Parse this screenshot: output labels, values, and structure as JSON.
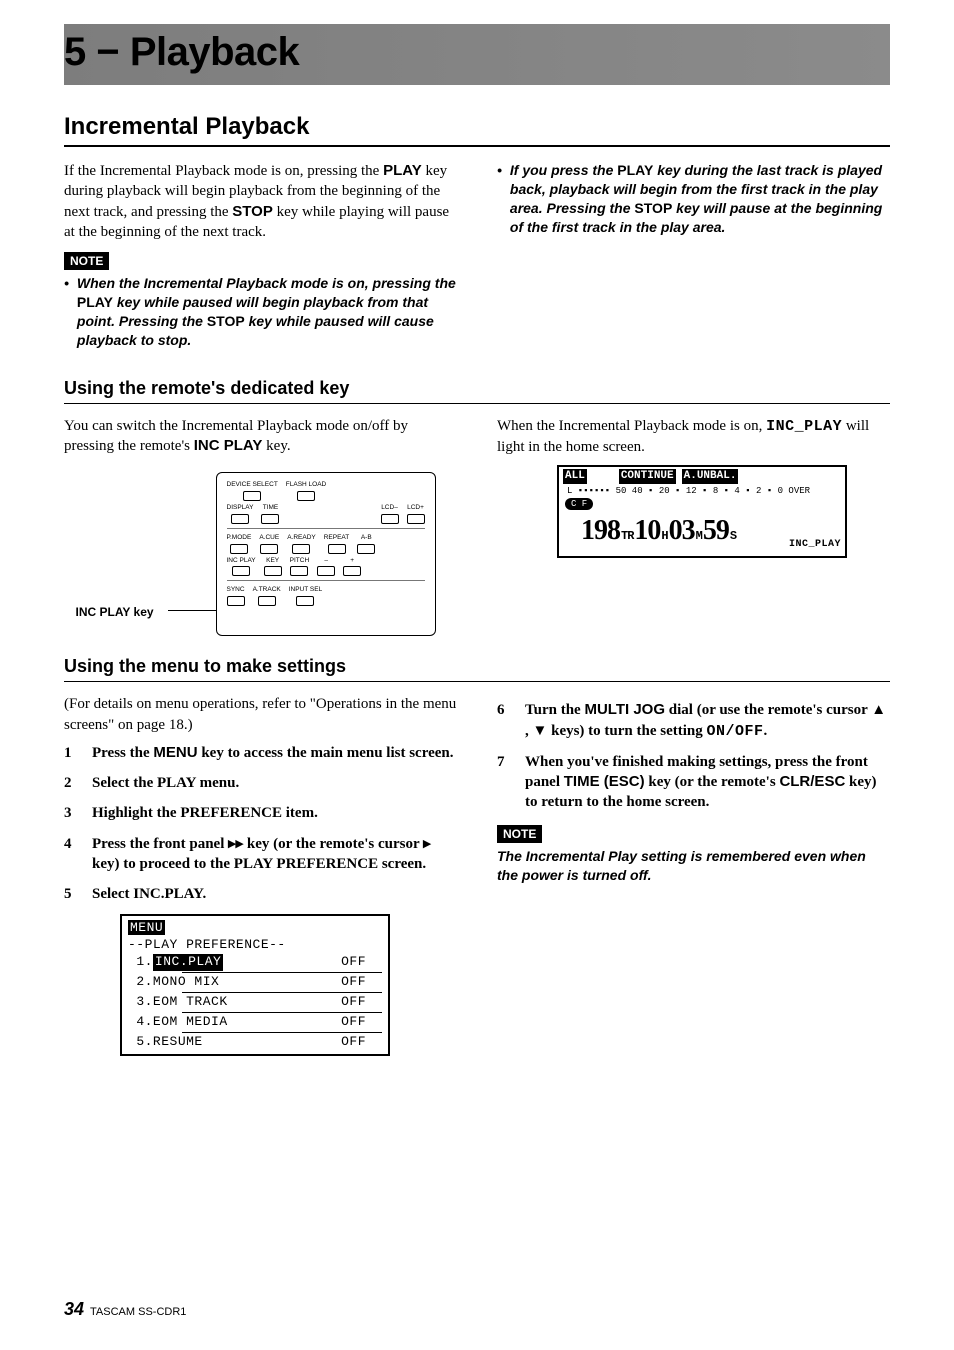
{
  "chapter": {
    "title": "5 − Playback"
  },
  "section1": {
    "heading": "Incremental Playback",
    "left": {
      "intro": "If the Incremental Playback mode is on, pressing the {PLAY} key during playback will begin playback from the beginning of the next track, and pressing the {STOP} key while playing will pause at the beginning of the next track.",
      "keys": {
        "play": "PLAY",
        "stop": "STOP"
      },
      "note_label": "NOTE",
      "note_bullet": "When the Incremental Playback mode is on, pressing the {PLAY} key while paused will begin playback from that point. Pressing the {STOP} key while paused will cause playback to stop."
    },
    "right": {
      "bullet": "If you press the {PLAY} key during the last track is played back, playback will begin from the first track in the play area. Pressing the {STOP} key will pause at the beginning of the first track in the play area."
    }
  },
  "section2": {
    "heading": "Using the remote's dedicated key",
    "left": {
      "p": "You can switch the Incremental Playback mode on/off by pressing the remote's {INCPLAY} key.",
      "inc_play_key": "INC PLAY",
      "diagram_label": "INC PLAY key",
      "remote_rows": {
        "r1": [
          "DEVICE SELECT",
          "FLASH LOAD"
        ],
        "r2": [
          "DISPLAY",
          "TIME",
          "",
          "LCD–",
          "LCD+"
        ],
        "r3": [
          "P.MODE",
          "A.CUE",
          "A.READY",
          "REPEAT",
          "A-B"
        ],
        "r4": [
          "INC PLAY",
          "KEY",
          "PITCH",
          "–",
          "+"
        ],
        "r5": [
          "SYNC",
          "A.TRACK",
          "INPUT SEL"
        ]
      }
    },
    "right": {
      "p1": "When the Incremental Playback mode is on, ",
      "mono": "INC_PLAY",
      "p2": " will light in the home screen.",
      "lcd": {
        "all": "ALL",
        "continue": "CONTINUE",
        "aunbal": "A.UNBAL.",
        "meter": "L  ▪▪▪▪▪▪  50 40 ▪ 20 ▪ 12 ▪  8  ▪  4  ▪  2  ▪  0 OVER",
        "cf": "C F",
        "track": "198",
        "tr": "TR",
        "h": "10",
        "hu": "H",
        "m": "03",
        "mu": "M",
        "s": "59",
        "su": "S",
        "incplay": "INC_PLAY"
      }
    }
  },
  "section3": {
    "heading": "Using the menu to make settings",
    "left": {
      "intro": "(For details on menu operations, refer to \"Operations in the menu screens\" on page 18.)",
      "steps": [
        "Press the {MENU} key to access the main menu list screen.",
        "Select the PLAY menu.",
        "Highlight the PREFERENCE item.",
        "Press the front panel ▸▸ key (or the remote's cursor ▸ key) to proceed to the PLAY PREFERENCE screen.",
        "Select INC.PLAY."
      ],
      "menu_key": "MENU",
      "lcd": {
        "header": "MENU",
        "subtitle": "--PLAY PREFERENCE--",
        "rows": [
          {
            "n": "1.",
            "label": "INC.PLAY",
            "val": "OFF",
            "sel": true
          },
          {
            "n": "2.",
            "label": "MONO MIX",
            "val": "OFF"
          },
          {
            "n": "3.",
            "label": "EOM TRACK",
            "val": "OFF"
          },
          {
            "n": "4.",
            "label": "EOM MEDIA",
            "val": "OFF"
          },
          {
            "n": "5.",
            "label": "RESUME",
            "val": "OFF"
          }
        ]
      }
    },
    "right": {
      "steps": [
        "Turn the {MULTIJOG} dial (or use the remote's cursor ▲ , ▼ keys) to turn the setting {ONOFF}.",
        "When you've finished making settings, press the front panel {TIMEESC} key (or the remote's {CLRESC} key) to return to the home screen."
      ],
      "keys": {
        "multi_jog": "MULTI JOG",
        "onoff": "ON/OFF",
        "time_esc": "TIME (ESC)",
        "clr_esc": "CLR/ESC"
      },
      "note_label": "NOTE",
      "note_body": "The Incremental Play setting is remembered even when the power is turned off."
    }
  },
  "footer": {
    "page": "34",
    "model": "TASCAM SS-CDR1"
  }
}
